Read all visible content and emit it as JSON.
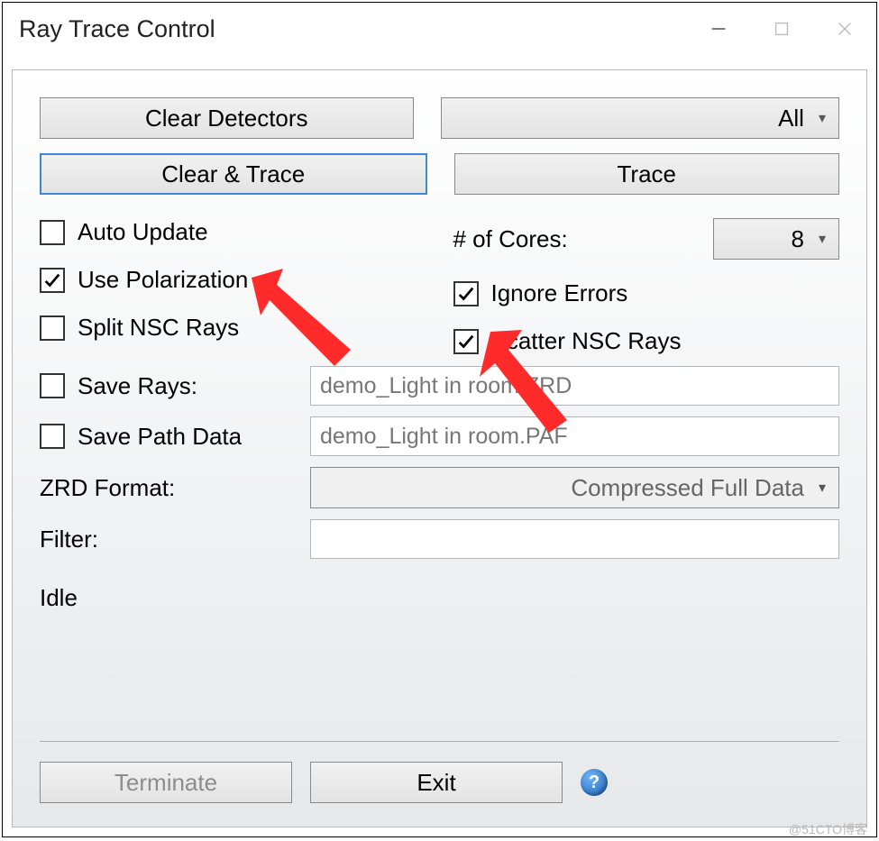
{
  "window": {
    "title": "Ray Trace Control"
  },
  "buttons": {
    "clear_detectors": "Clear Detectors",
    "clear_and_trace": "Clear & Trace",
    "trace": "Trace",
    "terminate": "Terminate",
    "exit": "Exit"
  },
  "detector_selector": {
    "value": "All"
  },
  "options": {
    "auto_update": {
      "label": "Auto Update",
      "checked": false
    },
    "use_polarization": {
      "label": "Use Polarization",
      "checked": true
    },
    "split_nsc_rays": {
      "label": "Split NSC Rays",
      "checked": false
    },
    "ignore_errors": {
      "label": "Ignore Errors",
      "checked": true
    },
    "scatter_nsc_rays": {
      "label": "Scatter NSC Rays",
      "checked": true
    }
  },
  "cores": {
    "label": "# of Cores:",
    "value": "8"
  },
  "save_rays": {
    "label": "Save Rays:",
    "checked": false,
    "value": "demo_Light in room.ZRD"
  },
  "save_path_data": {
    "label": "Save Path Data",
    "checked": false,
    "value": "demo_Light in room.PAF"
  },
  "zrd_format": {
    "label": "ZRD Format:",
    "value": "Compressed Full Data"
  },
  "filter": {
    "label": "Filter:",
    "value": ""
  },
  "status": "Idle",
  "watermark": "@51CTO博客"
}
